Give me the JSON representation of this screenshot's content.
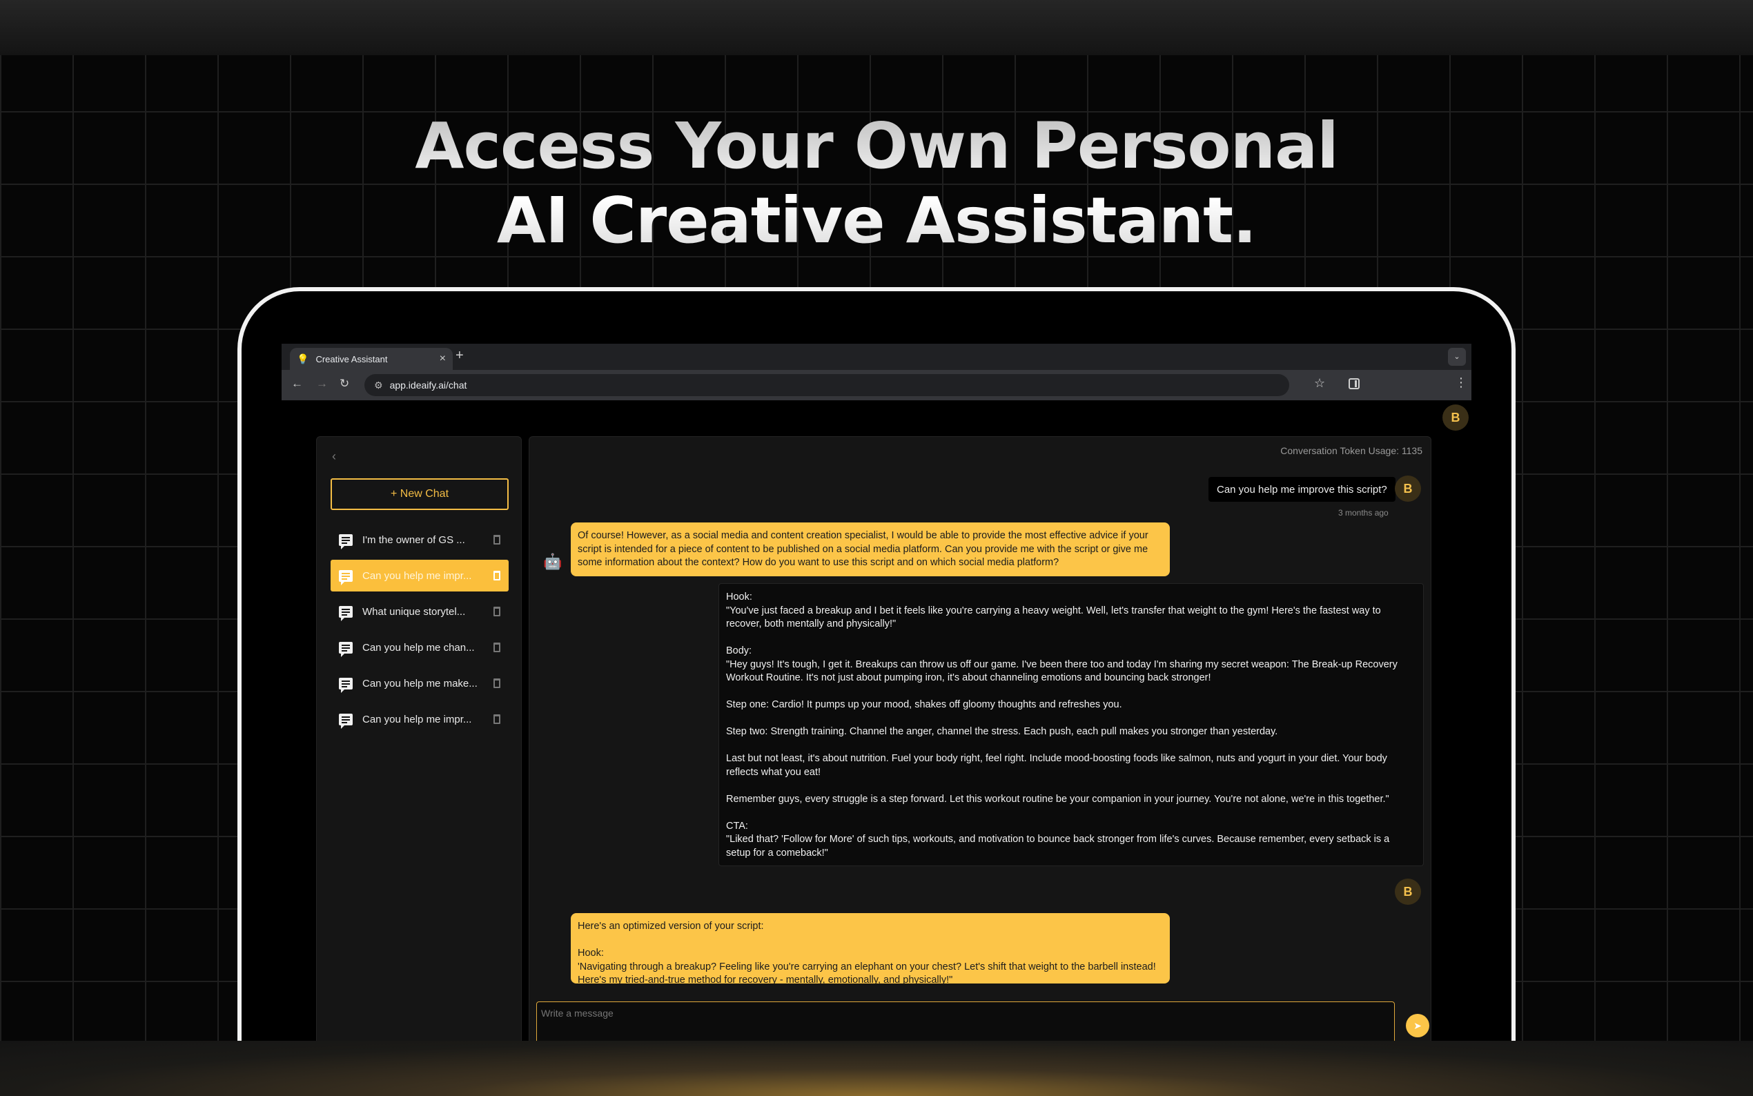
{
  "headline": {
    "line1": "Access Your Own Personal",
    "line2": "AI Creative Assistant."
  },
  "browser": {
    "tab_title": "Creative Assistant",
    "tab_icon": "lightbulb-icon",
    "url": "app.ideaify.ai/chat"
  },
  "user": {
    "avatar_letter": "B"
  },
  "sidebar": {
    "new_chat_label": "+ New Chat",
    "items": [
      {
        "label": "I'm the owner of GS ...",
        "active": false
      },
      {
        "label": "Can you help me impr...",
        "active": true
      },
      {
        "label": "What unique storytel...",
        "active": false
      },
      {
        "label": "Can you help me chan...",
        "active": false
      },
      {
        "label": "Can you help me make...",
        "active": false
      },
      {
        "label": "Can you help me impr...",
        "active": false
      }
    ]
  },
  "chat": {
    "token_usage": "Conversation Token Usage: 1135",
    "user_message": "Can you help me improve this script?",
    "user_message_time": "3 months ago",
    "bot_reply_1": "Of course! However, as a social media and content creation specialist, I would be able to provide the most effective advice if your script is intended for a piece of content to be published on a social media platform. Can you provide me with the script or give me some information about the context? How do you want to use this script and on which social media platform?",
    "user_script": "Hook:\n\"You've just faced a breakup and I bet it feels like you're carrying a heavy weight. Well, let's transfer that weight to the gym! Here's the fastest way to recover, both mentally and physically!\"\n\nBody:\n\"Hey guys! It's tough, I get it. Breakups can throw us off our game. I've been there too and today I'm sharing my secret weapon: The Break-up Recovery Workout Routine. It's not just about pumping iron, it's about channeling emotions and bouncing back stronger!\n\nStep one: Cardio! It pumps up your mood, shakes off gloomy thoughts and refreshes you.\n\nStep two: Strength training. Channel the anger, channel the stress. Each push, each pull makes you stronger than yesterday.\n\nLast but not least, it's about nutrition. Fuel your body right, feel right. Include mood-boosting foods like salmon, nuts and yogurt in your diet. Your body reflects what you eat!\n\nRemember guys, every struggle is a step forward. Let this workout routine be your companion in your journey. You're not alone, we're in this together.\"\n\nCTA:\n\"Liked that? 'Follow for More' of such tips, workouts, and motivation to bounce back stronger from life's curves. Because remember, every setback is a setup for a comeback!\"",
    "bot_reply_2": "Here's an optimized version of your script:\n\nHook:\n'Navigating through a breakup? Feeling like you're carrying an elephant on your chest? Let's shift that weight to the barbell instead! Here's my tried-and-true method for recovery - mentally, emotionally, and physically!\"",
    "input_placeholder": "Write a message"
  },
  "colors": {
    "accent": "#fcc548",
    "background": "#060606",
    "panel": "#151515"
  }
}
